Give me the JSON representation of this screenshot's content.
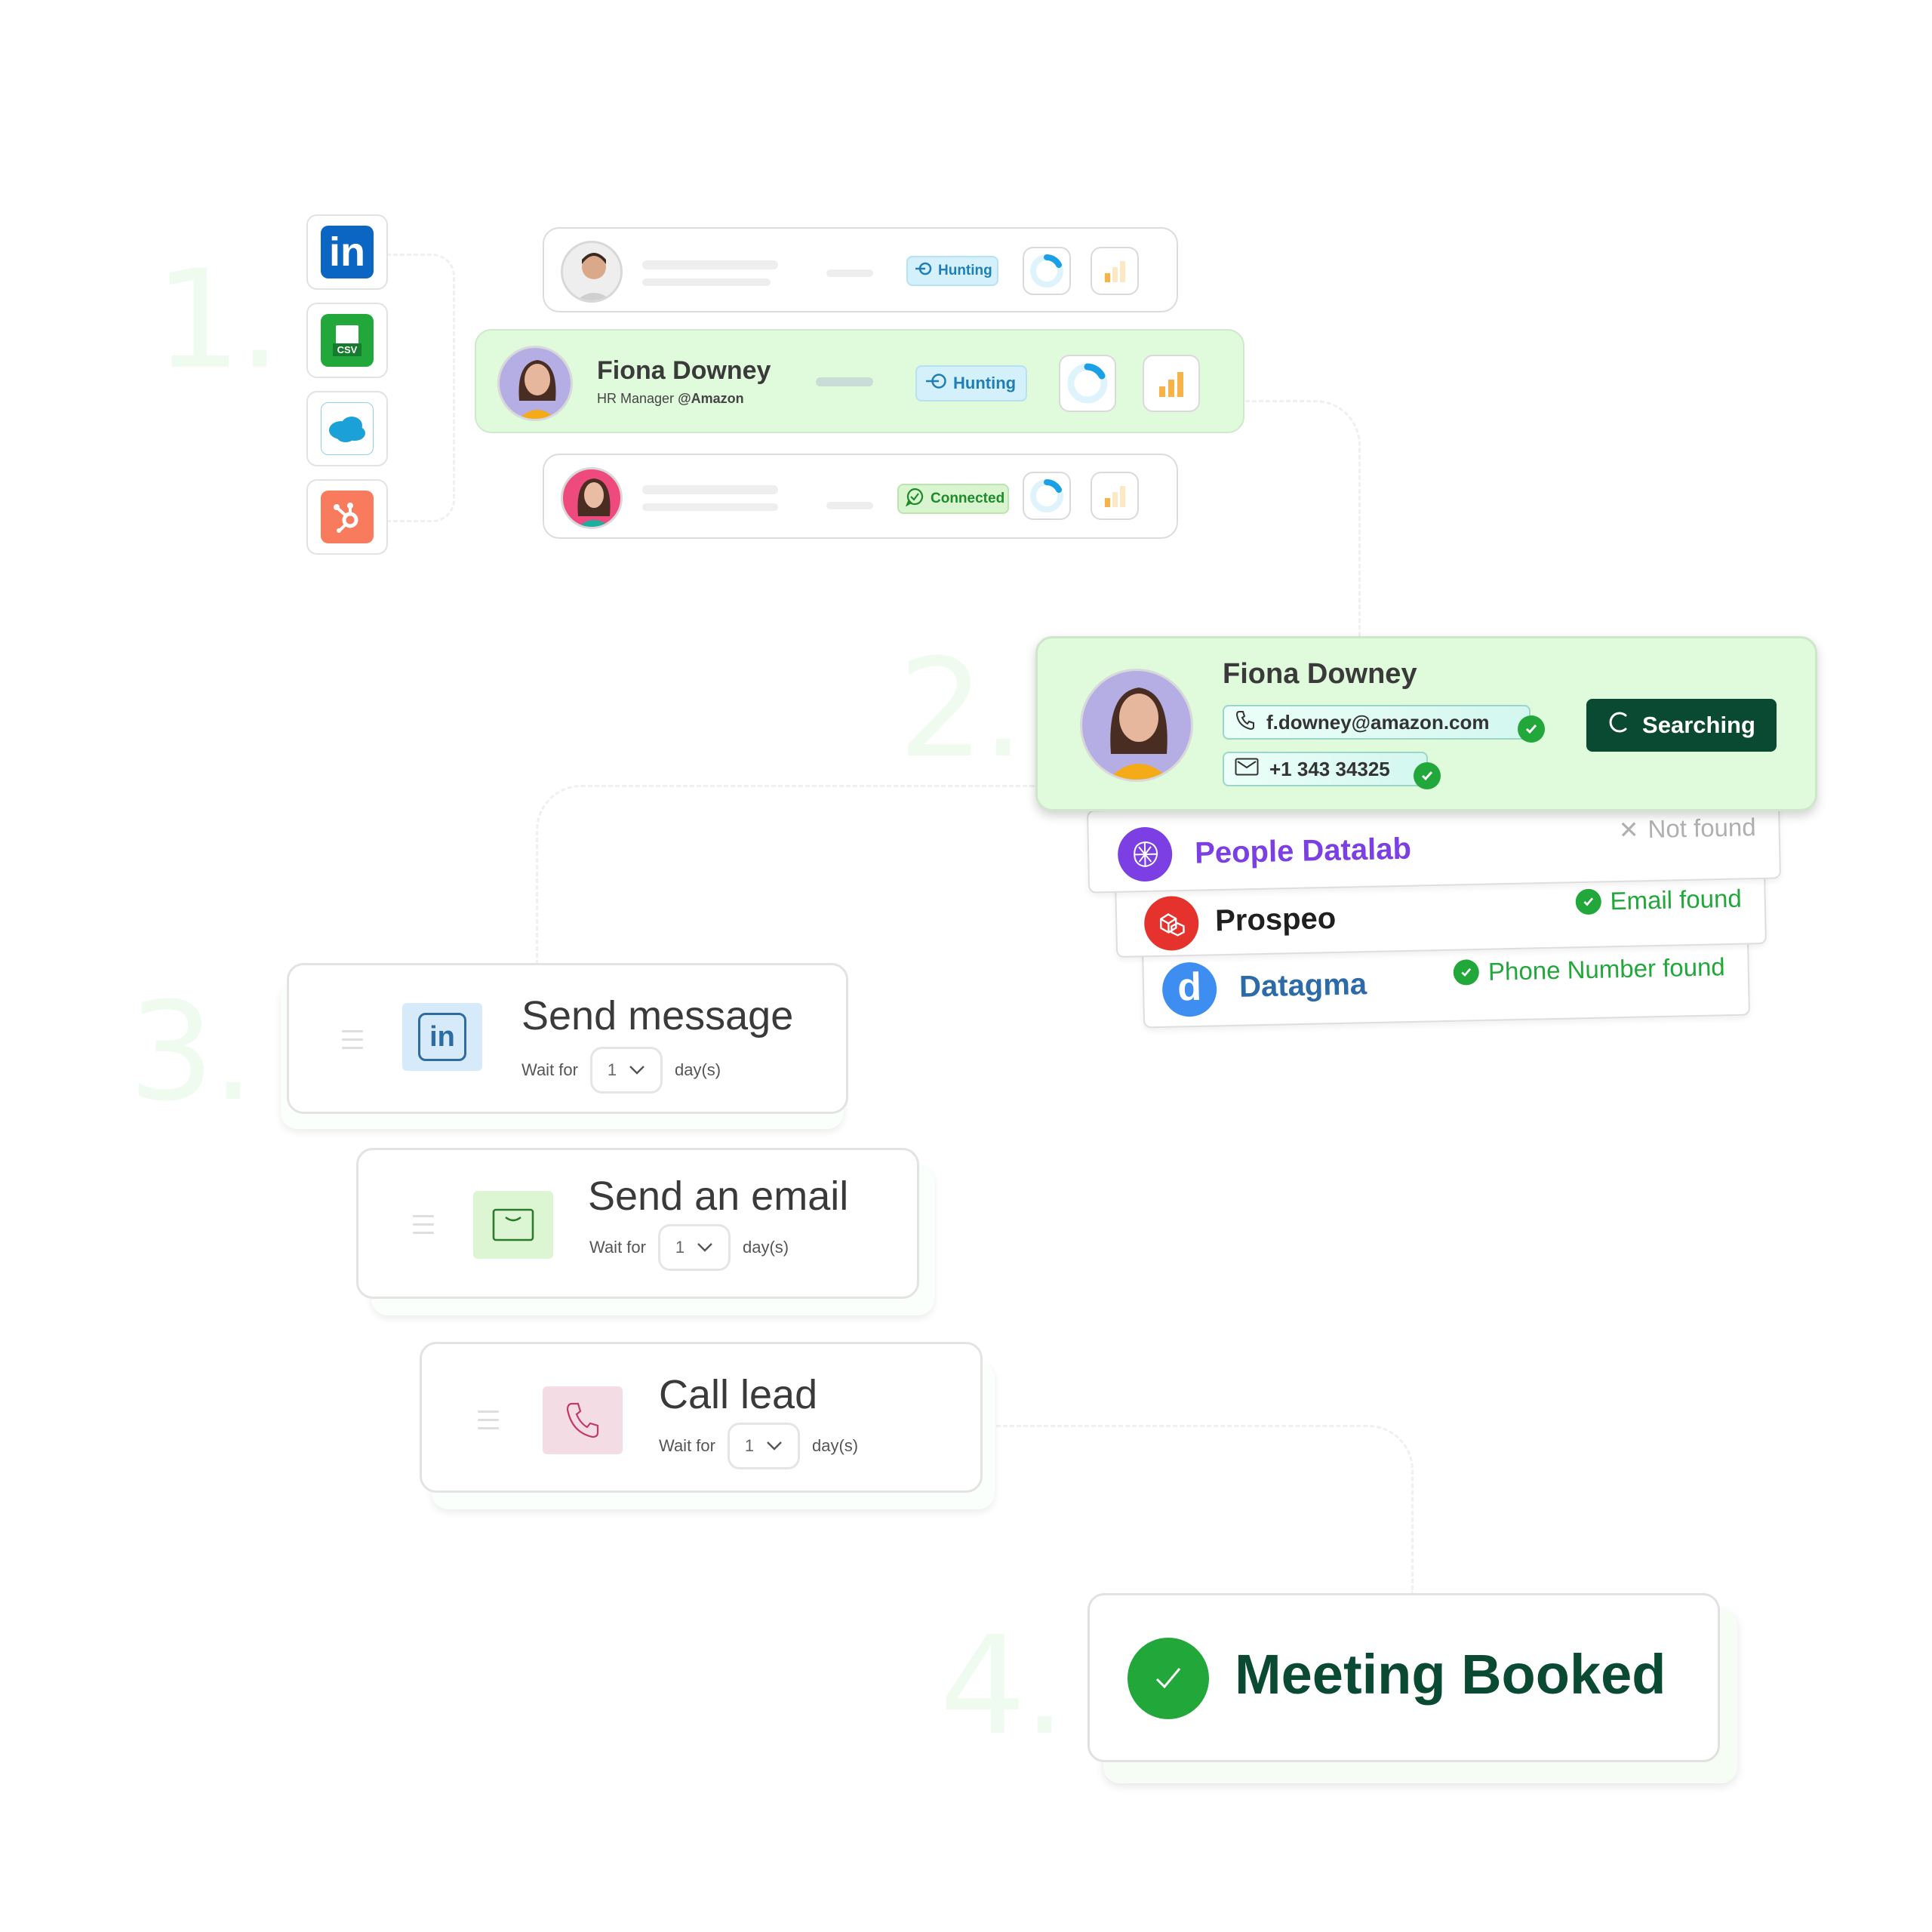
{
  "steps": {
    "one": "1.",
    "two": "2.",
    "three": "3.",
    "four": "4."
  },
  "sources": [
    {
      "name": "LinkedIn",
      "icon": "linkedin-icon",
      "label": "in"
    },
    {
      "name": "CSV",
      "icon": "csv-file-icon",
      "label": "CSV"
    },
    {
      "name": "Salesforce",
      "icon": "salesforce-icon",
      "label": "salesforce"
    },
    {
      "name": "HubSpot",
      "icon": "hubspot-icon",
      "label": ""
    }
  ],
  "leads": [
    {
      "name": "",
      "title": "",
      "status": "Hunting",
      "status_icon": "target-arrow-icon",
      "progress": 0.15,
      "signal_bars_active": 1
    },
    {
      "name": "Fiona Downey",
      "title": "HR Manager",
      "company": "@Amazon",
      "status": "Hunting",
      "status_icon": "target-arrow-icon",
      "progress": 0.15,
      "signal_bars_active": 3
    },
    {
      "name": "",
      "title": "",
      "status": "Connected",
      "status_icon": "chat-check-icon",
      "progress": 0.15,
      "signal_bars_active": 1
    }
  ],
  "enrichment": {
    "name": "Fiona Downey",
    "email": "f.downey@amazon.com",
    "phone": "+1 343 34325",
    "button_label": "Searching",
    "providers": [
      {
        "name": "People Datalab",
        "status": "Not found",
        "status_type": "not-found",
        "color": "#7b3fe4"
      },
      {
        "name": "Prospeo",
        "status": "Email found",
        "status_type": "found",
        "color": "#e5322d"
      },
      {
        "name": "Datagma",
        "status": "Phone Number found",
        "status_type": "found",
        "color": "#3d8ef0"
      }
    ]
  },
  "sequence": [
    {
      "title": "Send message",
      "channel": "linkedin",
      "wait_label": "Wait for",
      "wait_value": "1",
      "unit": "day(s)"
    },
    {
      "title": "Send an email",
      "channel": "email",
      "wait_label": "Wait for",
      "wait_value": "1",
      "unit": "day(s)"
    },
    {
      "title": "Call lead",
      "channel": "phone",
      "wait_label": "Wait for",
      "wait_value": "1",
      "unit": "day(s)"
    }
  ],
  "result": {
    "label": "Meeting Booked"
  },
  "colors": {
    "accent_green": "#22a83a",
    "dark_green": "#0b4a32",
    "light_green_bg": "#e0fadc",
    "hunting_blue": "#1f7fb5",
    "bar_orange": "#f6b34a"
  }
}
